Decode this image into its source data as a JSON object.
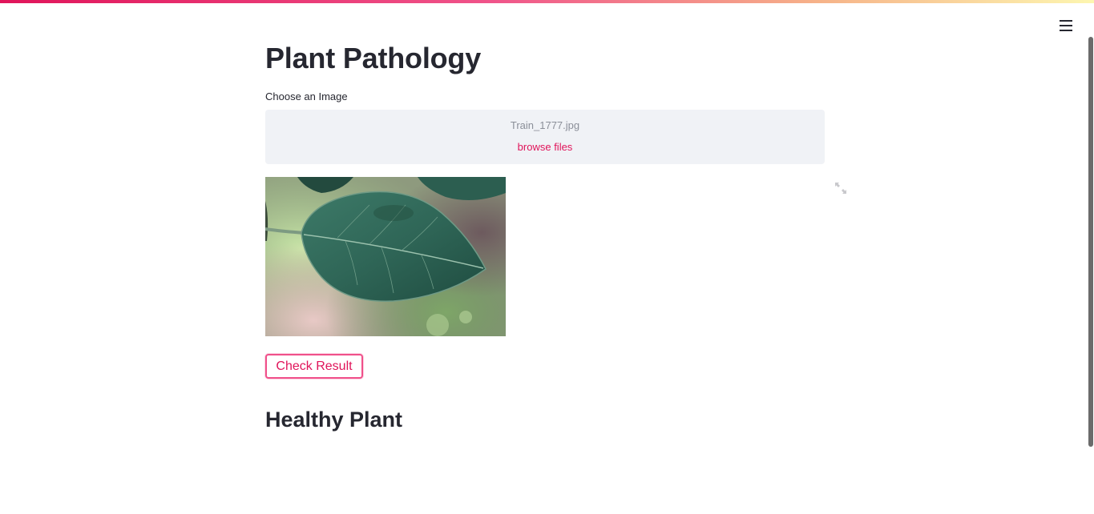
{
  "app": {
    "menu_icon": "hamburger-menu-icon",
    "accent_color": "#e0145a"
  },
  "main": {
    "title": "Plant Pathology",
    "uploader": {
      "label": "Choose an Image",
      "file_name": "Train_1777.jpg",
      "browse_label": "browse files"
    },
    "image": {
      "description_icon": "leaf-photo",
      "fullscreen_icon": "expand-arrows-icon"
    },
    "check_button_label": "Check Result",
    "result_text": "Healthy Plant"
  }
}
